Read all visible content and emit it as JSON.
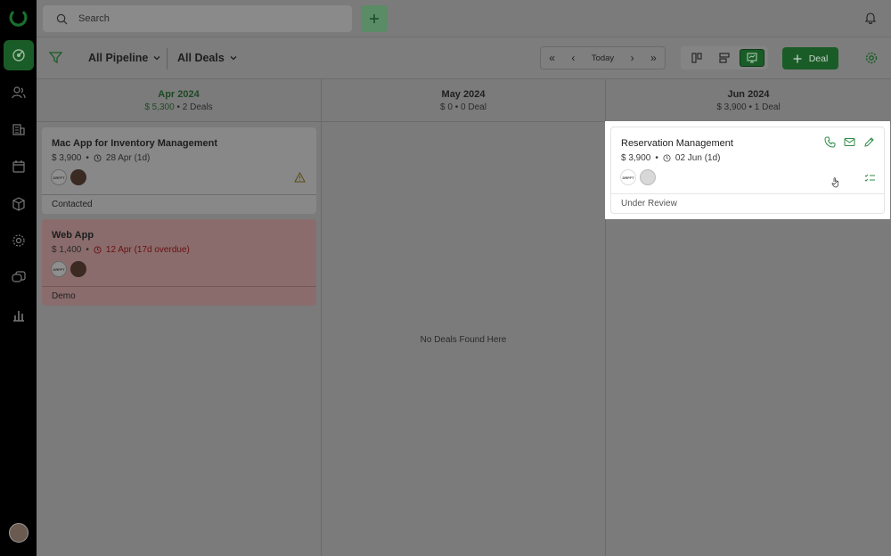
{
  "colors": {
    "brand": "#1a5c27",
    "overdue": "#c0392b",
    "accent": "#2e8b46"
  },
  "topbar": {
    "search_placeholder": "Search"
  },
  "toolbar": {
    "pipeline_label": "All Pipeline",
    "deals_filter_label": "All Deals",
    "today_label": "Today",
    "new_deal_label": "Deal"
  },
  "columns": [
    {
      "month": "Apr 2024",
      "amount": "$ 5,300",
      "count": "2 Deals"
    },
    {
      "month": "May 2024",
      "amount": "$ 0",
      "count": "0 Deal",
      "empty_text": "No Deals Found Here"
    },
    {
      "month": "Jun 2024",
      "amount": "$ 3,900",
      "count": "1 Deal"
    }
  ],
  "cards": [
    {
      "title": "Mac App for Inventory Management",
      "amount": "$ 3,900",
      "date": "28 Apr (1d)",
      "stage": "Contacted",
      "company_logo": "DRFFT"
    },
    {
      "title": "Web App",
      "amount": "$ 1,400",
      "date": "12 Apr (17d overdue)",
      "stage": "Demo",
      "company_logo": "DRFFT"
    },
    {
      "title": "Reservation Management",
      "amount": "$ 3,900",
      "date": "02 Jun (1d)",
      "stage": "Under Review",
      "company_logo": "DRFFT"
    }
  ],
  "separator": "•"
}
